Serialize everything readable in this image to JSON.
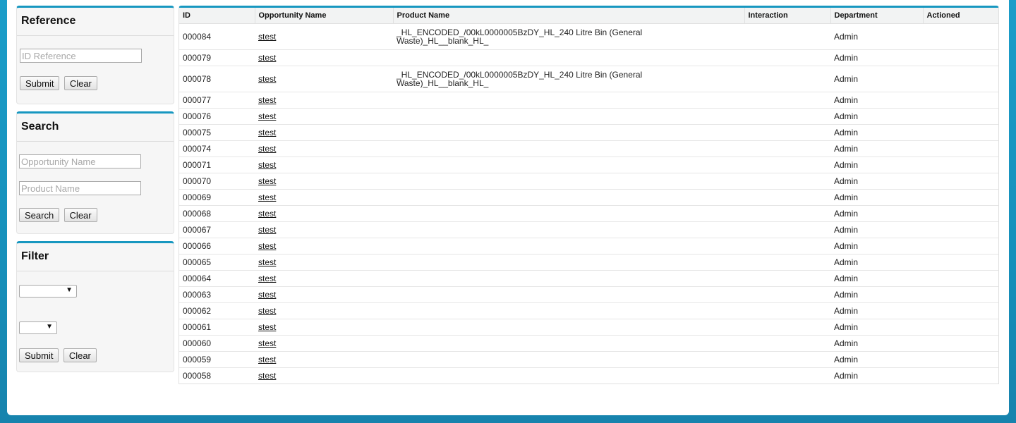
{
  "reference": {
    "title": "Reference",
    "id_placeholder": "ID Reference",
    "submit": "Submit",
    "clear": "Clear"
  },
  "search": {
    "title": "Search",
    "opportunity_placeholder": "Opportunity Name",
    "product_placeholder": "Product Name",
    "search": "Search",
    "clear": "Clear"
  },
  "filter": {
    "title": "Filter",
    "select1": "",
    "select2": "",
    "submit": "Submit",
    "clear": "Clear"
  },
  "table": {
    "columns": [
      "ID",
      "Opportunity Name",
      "Product Name",
      "Interaction",
      "Department",
      "Actioned"
    ],
    "rows": [
      {
        "id": "000084",
        "opportunity": "stest",
        "product": "_HL_ENCODED_/00kL0000005BzDY_HL_240 Litre Bin (General Waste)_HL__blank_HL_",
        "interaction": "",
        "department": "Admin",
        "actioned": ""
      },
      {
        "id": "000079",
        "opportunity": "stest",
        "product": "",
        "interaction": "",
        "department": "Admin",
        "actioned": ""
      },
      {
        "id": "000078",
        "opportunity": "stest",
        "product": "_HL_ENCODED_/00kL0000005BzDY_HL_240 Litre Bin (General Waste)_HL__blank_HL_",
        "interaction": "",
        "department": "Admin",
        "actioned": ""
      },
      {
        "id": "000077",
        "opportunity": "stest",
        "product": "",
        "interaction": "",
        "department": "Admin",
        "actioned": ""
      },
      {
        "id": "000076",
        "opportunity": "stest",
        "product": "",
        "interaction": "",
        "department": "Admin",
        "actioned": ""
      },
      {
        "id": "000075",
        "opportunity": "stest",
        "product": "",
        "interaction": "",
        "department": "Admin",
        "actioned": ""
      },
      {
        "id": "000074",
        "opportunity": "stest",
        "product": "",
        "interaction": "",
        "department": "Admin",
        "actioned": ""
      },
      {
        "id": "000071",
        "opportunity": "stest",
        "product": "",
        "interaction": "",
        "department": "Admin",
        "actioned": ""
      },
      {
        "id": "000070",
        "opportunity": "stest",
        "product": "",
        "interaction": "",
        "department": "Admin",
        "actioned": ""
      },
      {
        "id": "000069",
        "opportunity": "stest",
        "product": "",
        "interaction": "",
        "department": "Admin",
        "actioned": ""
      },
      {
        "id": "000068",
        "opportunity": "stest",
        "product": "",
        "interaction": "",
        "department": "Admin",
        "actioned": ""
      },
      {
        "id": "000067",
        "opportunity": "stest",
        "product": "",
        "interaction": "",
        "department": "Admin",
        "actioned": ""
      },
      {
        "id": "000066",
        "opportunity": "stest",
        "product": "",
        "interaction": "",
        "department": "Admin",
        "actioned": ""
      },
      {
        "id": "000065",
        "opportunity": "stest",
        "product": "",
        "interaction": "",
        "department": "Admin",
        "actioned": ""
      },
      {
        "id": "000064",
        "opportunity": "stest",
        "product": "",
        "interaction": "",
        "department": "Admin",
        "actioned": ""
      },
      {
        "id": "000063",
        "opportunity": "stest",
        "product": "",
        "interaction": "",
        "department": "Admin",
        "actioned": ""
      },
      {
        "id": "000062",
        "opportunity": "stest",
        "product": "",
        "interaction": "",
        "department": "Admin",
        "actioned": ""
      },
      {
        "id": "000061",
        "opportunity": "stest",
        "product": "",
        "interaction": "",
        "department": "Admin",
        "actioned": ""
      },
      {
        "id": "000060",
        "opportunity": "stest",
        "product": "",
        "interaction": "",
        "department": "Admin",
        "actioned": ""
      },
      {
        "id": "000059",
        "opportunity": "stest",
        "product": "",
        "interaction": "",
        "department": "Admin",
        "actioned": ""
      },
      {
        "id": "000058",
        "opportunity": "stest",
        "product": "",
        "interaction": "",
        "department": "Admin",
        "actioned": ""
      }
    ]
  }
}
